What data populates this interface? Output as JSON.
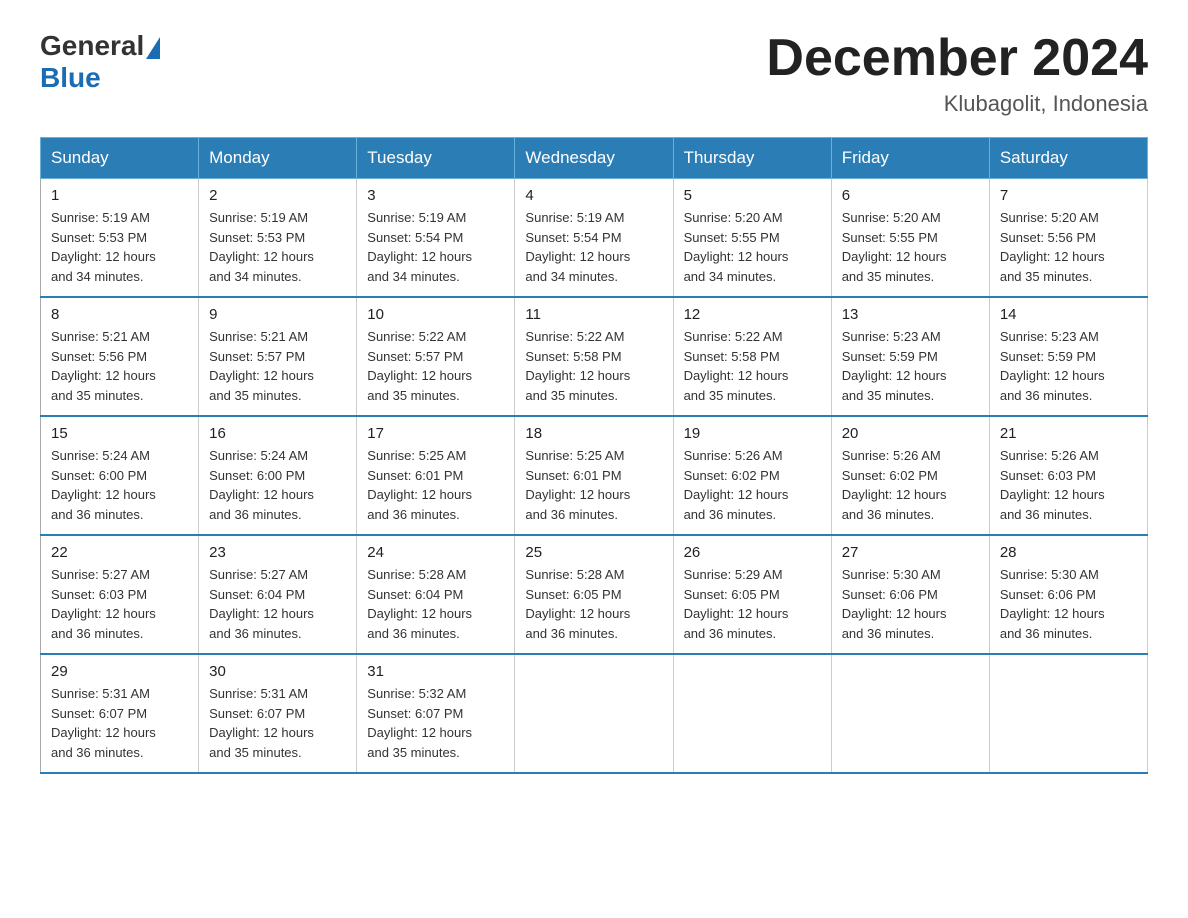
{
  "header": {
    "logo_general": "General",
    "logo_blue": "Blue",
    "month_title": "December 2024",
    "location": "Klubagolit, Indonesia"
  },
  "weekdays": [
    "Sunday",
    "Monday",
    "Tuesday",
    "Wednesday",
    "Thursday",
    "Friday",
    "Saturday"
  ],
  "weeks": [
    [
      {
        "day": "1",
        "sunrise": "5:19 AM",
        "sunset": "5:53 PM",
        "daylight": "12 hours and 34 minutes."
      },
      {
        "day": "2",
        "sunrise": "5:19 AM",
        "sunset": "5:53 PM",
        "daylight": "12 hours and 34 minutes."
      },
      {
        "day": "3",
        "sunrise": "5:19 AM",
        "sunset": "5:54 PM",
        "daylight": "12 hours and 34 minutes."
      },
      {
        "day": "4",
        "sunrise": "5:19 AM",
        "sunset": "5:54 PM",
        "daylight": "12 hours and 34 minutes."
      },
      {
        "day": "5",
        "sunrise": "5:20 AM",
        "sunset": "5:55 PM",
        "daylight": "12 hours and 34 minutes."
      },
      {
        "day": "6",
        "sunrise": "5:20 AM",
        "sunset": "5:55 PM",
        "daylight": "12 hours and 35 minutes."
      },
      {
        "day": "7",
        "sunrise": "5:20 AM",
        "sunset": "5:56 PM",
        "daylight": "12 hours and 35 minutes."
      }
    ],
    [
      {
        "day": "8",
        "sunrise": "5:21 AM",
        "sunset": "5:56 PM",
        "daylight": "12 hours and 35 minutes."
      },
      {
        "day": "9",
        "sunrise": "5:21 AM",
        "sunset": "5:57 PM",
        "daylight": "12 hours and 35 minutes."
      },
      {
        "day": "10",
        "sunrise": "5:22 AM",
        "sunset": "5:57 PM",
        "daylight": "12 hours and 35 minutes."
      },
      {
        "day": "11",
        "sunrise": "5:22 AM",
        "sunset": "5:58 PM",
        "daylight": "12 hours and 35 minutes."
      },
      {
        "day": "12",
        "sunrise": "5:22 AM",
        "sunset": "5:58 PM",
        "daylight": "12 hours and 35 minutes."
      },
      {
        "day": "13",
        "sunrise": "5:23 AM",
        "sunset": "5:59 PM",
        "daylight": "12 hours and 35 minutes."
      },
      {
        "day": "14",
        "sunrise": "5:23 AM",
        "sunset": "5:59 PM",
        "daylight": "12 hours and 36 minutes."
      }
    ],
    [
      {
        "day": "15",
        "sunrise": "5:24 AM",
        "sunset": "6:00 PM",
        "daylight": "12 hours and 36 minutes."
      },
      {
        "day": "16",
        "sunrise": "5:24 AM",
        "sunset": "6:00 PM",
        "daylight": "12 hours and 36 minutes."
      },
      {
        "day": "17",
        "sunrise": "5:25 AM",
        "sunset": "6:01 PM",
        "daylight": "12 hours and 36 minutes."
      },
      {
        "day": "18",
        "sunrise": "5:25 AM",
        "sunset": "6:01 PM",
        "daylight": "12 hours and 36 minutes."
      },
      {
        "day": "19",
        "sunrise": "5:26 AM",
        "sunset": "6:02 PM",
        "daylight": "12 hours and 36 minutes."
      },
      {
        "day": "20",
        "sunrise": "5:26 AM",
        "sunset": "6:02 PM",
        "daylight": "12 hours and 36 minutes."
      },
      {
        "day": "21",
        "sunrise": "5:26 AM",
        "sunset": "6:03 PM",
        "daylight": "12 hours and 36 minutes."
      }
    ],
    [
      {
        "day": "22",
        "sunrise": "5:27 AM",
        "sunset": "6:03 PM",
        "daylight": "12 hours and 36 minutes."
      },
      {
        "day": "23",
        "sunrise": "5:27 AM",
        "sunset": "6:04 PM",
        "daylight": "12 hours and 36 minutes."
      },
      {
        "day": "24",
        "sunrise": "5:28 AM",
        "sunset": "6:04 PM",
        "daylight": "12 hours and 36 minutes."
      },
      {
        "day": "25",
        "sunrise": "5:28 AM",
        "sunset": "6:05 PM",
        "daylight": "12 hours and 36 minutes."
      },
      {
        "day": "26",
        "sunrise": "5:29 AM",
        "sunset": "6:05 PM",
        "daylight": "12 hours and 36 minutes."
      },
      {
        "day": "27",
        "sunrise": "5:30 AM",
        "sunset": "6:06 PM",
        "daylight": "12 hours and 36 minutes."
      },
      {
        "day": "28",
        "sunrise": "5:30 AM",
        "sunset": "6:06 PM",
        "daylight": "12 hours and 36 minutes."
      }
    ],
    [
      {
        "day": "29",
        "sunrise": "5:31 AM",
        "sunset": "6:07 PM",
        "daylight": "12 hours and 36 minutes."
      },
      {
        "day": "30",
        "sunrise": "5:31 AM",
        "sunset": "6:07 PM",
        "daylight": "12 hours and 35 minutes."
      },
      {
        "day": "31",
        "sunrise": "5:32 AM",
        "sunset": "6:07 PM",
        "daylight": "12 hours and 35 minutes."
      },
      null,
      null,
      null,
      null
    ]
  ],
  "labels": {
    "sunrise": "Sunrise:",
    "sunset": "Sunset:",
    "daylight": "Daylight:"
  }
}
